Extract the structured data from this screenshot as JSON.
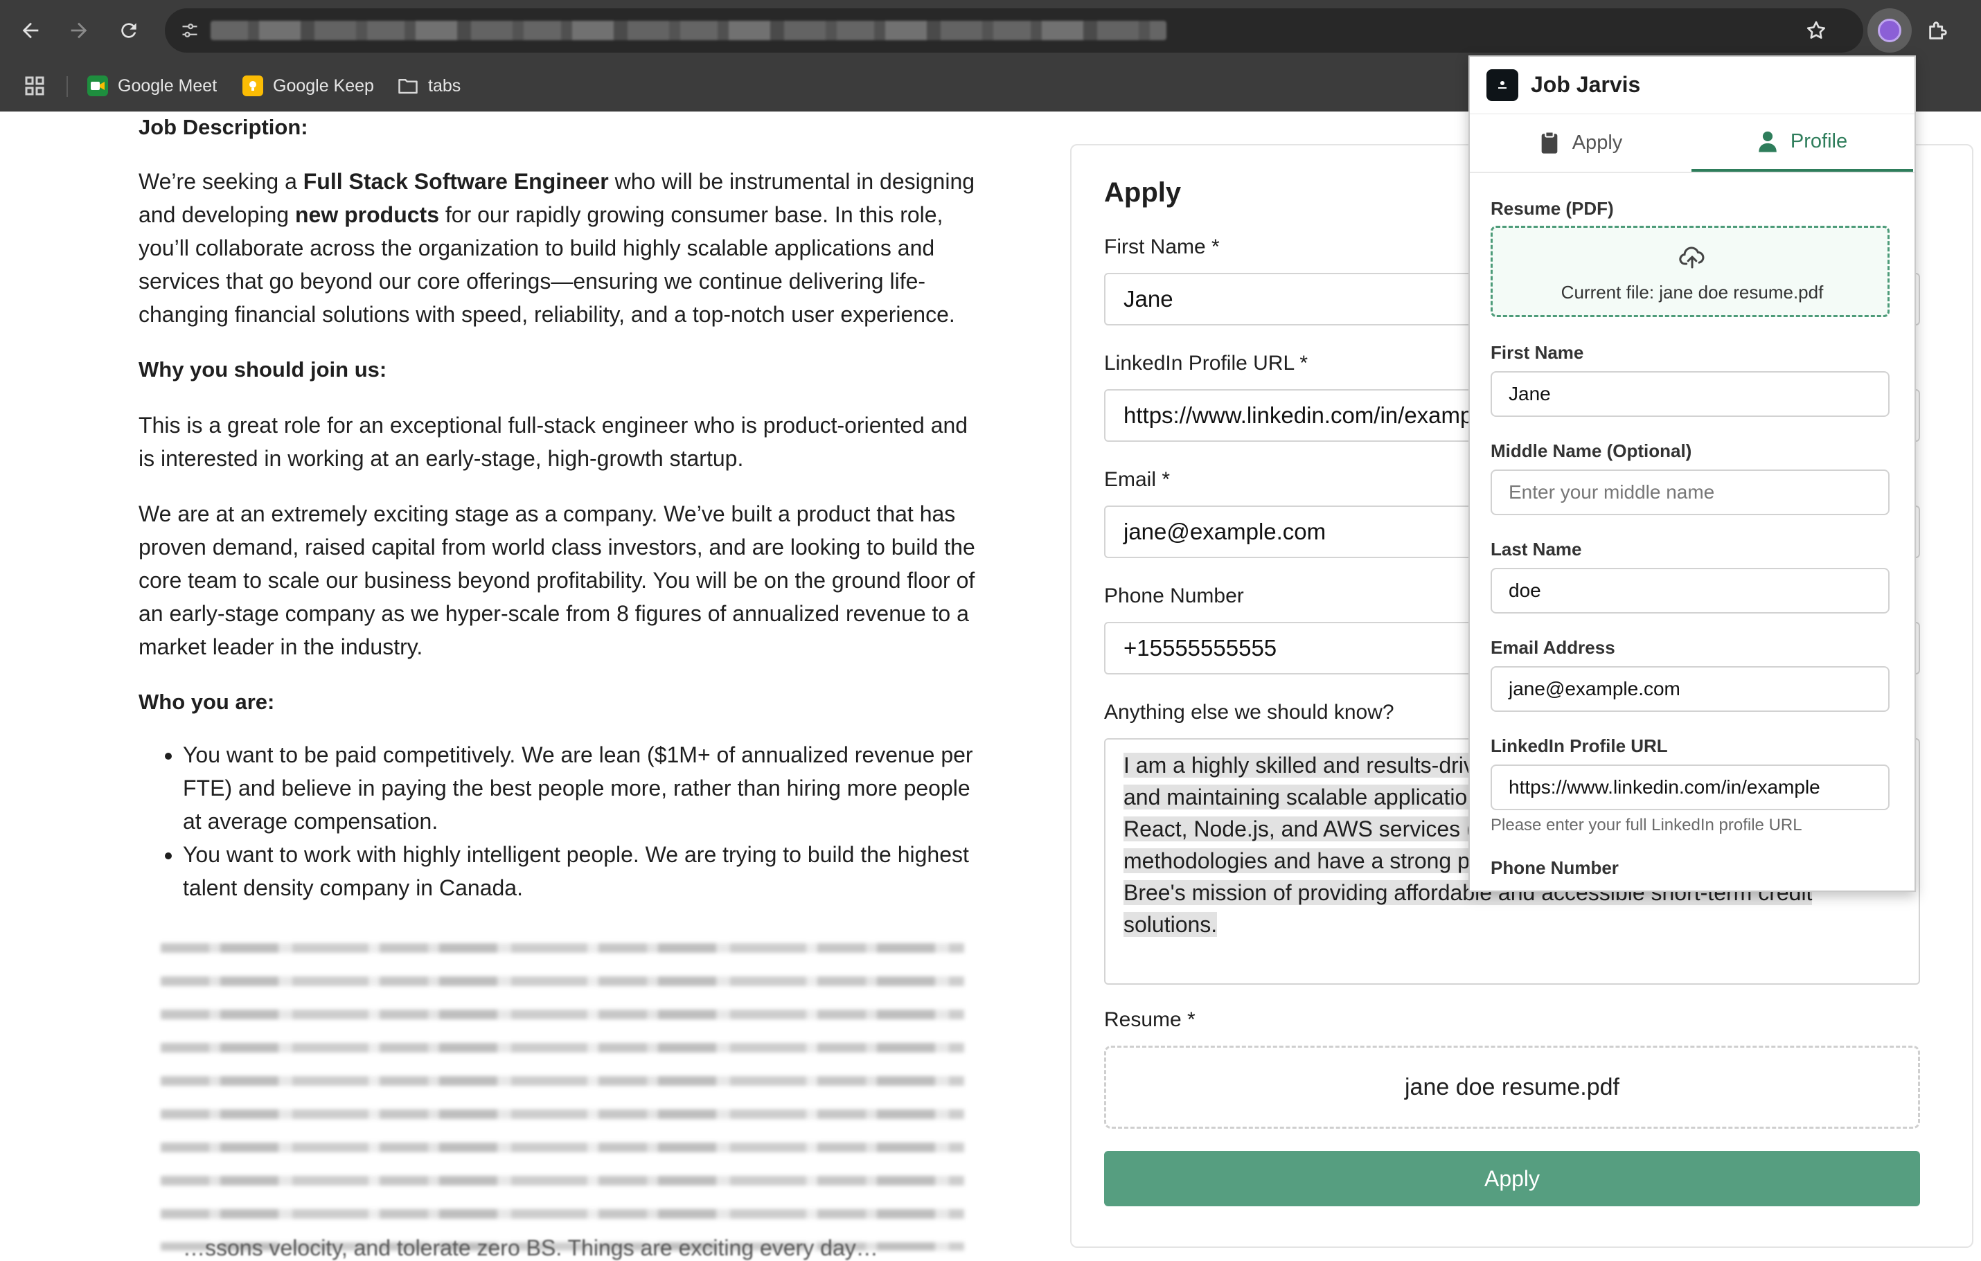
{
  "browser": {
    "bookmarks": [
      {
        "label": "Google Meet",
        "icon": "google-meet-icon",
        "color": "#1e8e3e"
      },
      {
        "label": "Google Keep",
        "icon": "google-keep-icon",
        "color": "#fbbc04"
      },
      {
        "label": "tabs",
        "icon": "folder-icon"
      }
    ]
  },
  "job": {
    "h_description": "Job Description:",
    "p1_pre": "We’re seeking a ",
    "p1_b1": "Full Stack Software Engineer",
    "p1_mid": " who will be instrumental in designing and developing ",
    "p1_b2": "new products",
    "p1_post": " for our rapidly growing consumer base. In this role, you’ll collaborate across the organization to build highly scalable applications and services that go beyond our core offerings—ensuring we continue delivering life-changing financial solutions with speed, reliability, and a top-notch user experience.",
    "h_why": "Why you should join us:",
    "p2": "This is a great role for an exceptional full-stack engineer who is product-oriented and is interested in working at an early-stage, high-growth startup.",
    "p3": "We are at an extremely exciting stage as a company. We’ve built a product that has proven demand, raised capital from world class investors, and are looking to build the core team to scale our business beyond profitability. You will be on the ground floor of an early-stage company as we hyper-scale from 8 figures of annualized revenue to a market leader in the industry.",
    "h_who": "Who you are:",
    "bullets": [
      "You want to be paid competitively. We are lean ($1M+ of annualized revenue per FTE) and believe in paying the best people more, rather than hiring more people at average compensation.",
      "You want to work with highly intelligent people. We are trying to build the highest talent density company in Canada."
    ],
    "cut_line": "…ssons velocity, and tolerate zero BS. Things are exciting every day…"
  },
  "form": {
    "title": "Apply",
    "first_name_label": "First Name *",
    "first_name_value": "Jane",
    "linkedin_label": "LinkedIn Profile URL *",
    "linkedin_value": "https://www.linkedin.com/in/example",
    "email_label": "Email *",
    "email_value": "jane@example.com",
    "phone_label": "Phone Number",
    "phone_value": "+15555555555",
    "anything_label": "Anything else we should know?",
    "anything_value": "I am a highly skilled and results-driven engineer with experience in building and maintaining scalable applications. My expertise includes React Native, React, Node.js, and AWS services (especially Lambda). I am familiar with agile methodologies and have a strong product sense. I am eager to contribute to Bree's mission of providing affordable and accessible short-term credit solutions.",
    "resume_label": "Resume *",
    "resume_file": "jane doe resume.pdf",
    "apply_button": "Apply",
    "accent": "#569e80"
  },
  "popup": {
    "title": "Job Jarvis",
    "tabs": [
      {
        "label": "Apply",
        "icon": "clipboard-icon",
        "active": false
      },
      {
        "label": "Profile",
        "icon": "person-icon",
        "active": true
      }
    ],
    "resume_label": "Resume (PDF)",
    "current_file": "Current file: jane doe resume.pdf",
    "first_name_label": "First Name",
    "first_name_value": "Jane",
    "middle_name_label": "Middle Name (Optional)",
    "middle_name_placeholder": "Enter your middle name",
    "last_name_label": "Last Name",
    "last_name_value": "doe",
    "email_label": "Email Address",
    "email_value": "jane@example.com",
    "linkedin_label": "LinkedIn Profile URL",
    "linkedin_value": "https://www.linkedin.com/in/example",
    "linkedin_hint": "Please enter your full LinkedIn profile URL",
    "phone_label": "Phone Number",
    "accent": "#2e7d5b"
  }
}
